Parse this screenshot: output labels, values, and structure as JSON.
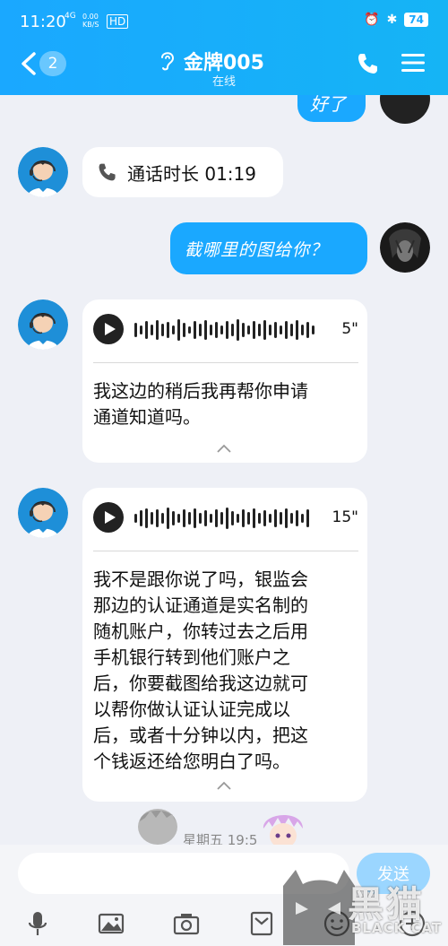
{
  "status": {
    "time": "11:20",
    "network": "4G",
    "speed": "0.00\nKB/S",
    "hd": "HD",
    "battery": "74"
  },
  "header": {
    "back_count": "2",
    "title": "金牌005",
    "subtitle": "在线"
  },
  "messages": {
    "partial_out": "好了",
    "call": {
      "text": "通话时长 01:19"
    },
    "out_text": "截哪里的图给你？",
    "voice1": {
      "duration": "5\"",
      "transcript": "我这边的稍后我再帮你申请\n通道知道吗。"
    },
    "voice2": {
      "duration": "15\"",
      "transcript": "我不是跟你说了吗，银监会\n那边的认证通道是实名制的\n随机账户，你转过去之后用\n手机银行转到他们账户之\n后，你要截图给我这边就可\n以帮你做认证认证完成以\n后，或者十分钟以内，把这\n个钱返还给您明白了吗。"
    },
    "weekday": "星期五 19:5"
  },
  "input": {
    "placeholder": "",
    "send_label": "发送"
  },
  "watermark": {
    "text": "黑猫",
    "sub": "BLACK CAT"
  },
  "colors": {
    "accent": "#1aa8ff",
    "background": "#eef0f6"
  },
  "toolbar": [
    "mic-icon",
    "image-icon",
    "camera-icon",
    "folder-icon",
    "emoji-icon",
    "plus-icon"
  ]
}
